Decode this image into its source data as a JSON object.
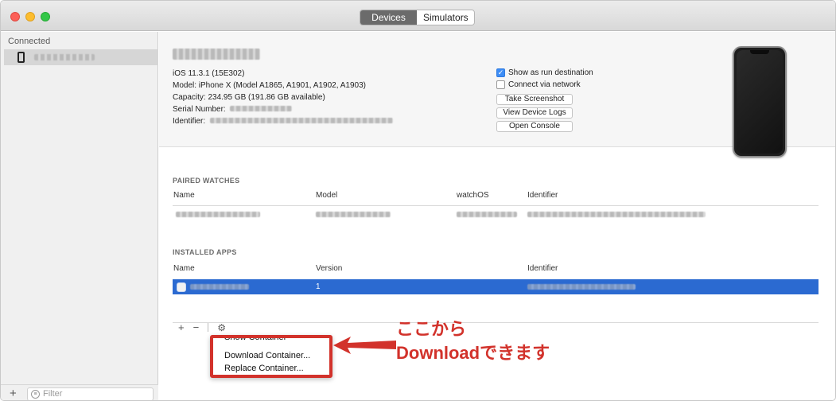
{
  "window": {
    "segmented": {
      "active": "Devices",
      "inactive": "Simulators"
    }
  },
  "sidebar": {
    "header": "Connected",
    "filter_placeholder": "Filter",
    "add_label": "+"
  },
  "device": {
    "ios": "iOS 11.3.1 (15E302)",
    "model": "Model: iPhone X (Model A1865, A1901, A1902, A1903)",
    "capacity": "Capacity: 234.95 GB (191.86 GB available)",
    "serial_label": "Serial Number:",
    "identifier_label": "Identifier:",
    "show_run_destination": {
      "label": "Show as run destination",
      "checked": true
    },
    "connect_network": {
      "label": "Connect via network",
      "checked": false
    },
    "buttons": {
      "screenshot": "Take Screenshot",
      "logs": "View Device Logs",
      "console": "Open Console"
    }
  },
  "paired_watches": {
    "title": "PAIRED WATCHES",
    "columns": [
      "Name",
      "Model",
      "watchOS",
      "Identifier"
    ]
  },
  "installed_apps": {
    "title": "INSTALLED APPS",
    "columns": [
      "Name",
      "Version",
      "Identifier"
    ],
    "selected_row": {
      "version": "1"
    }
  },
  "toolbar": {
    "add": "+",
    "remove": "−",
    "gear_icon": "gear-icon"
  },
  "context_menu": {
    "items": [
      "Show Container",
      "Download Container...",
      "Replace Container..."
    ]
  },
  "annotation": {
    "line1": "ここから",
    "line2": "Downloadできます",
    "color": "#d2322b"
  },
  "colors": {
    "selection": "#2b6ad1",
    "checkbox_on": "#3d8df5"
  }
}
